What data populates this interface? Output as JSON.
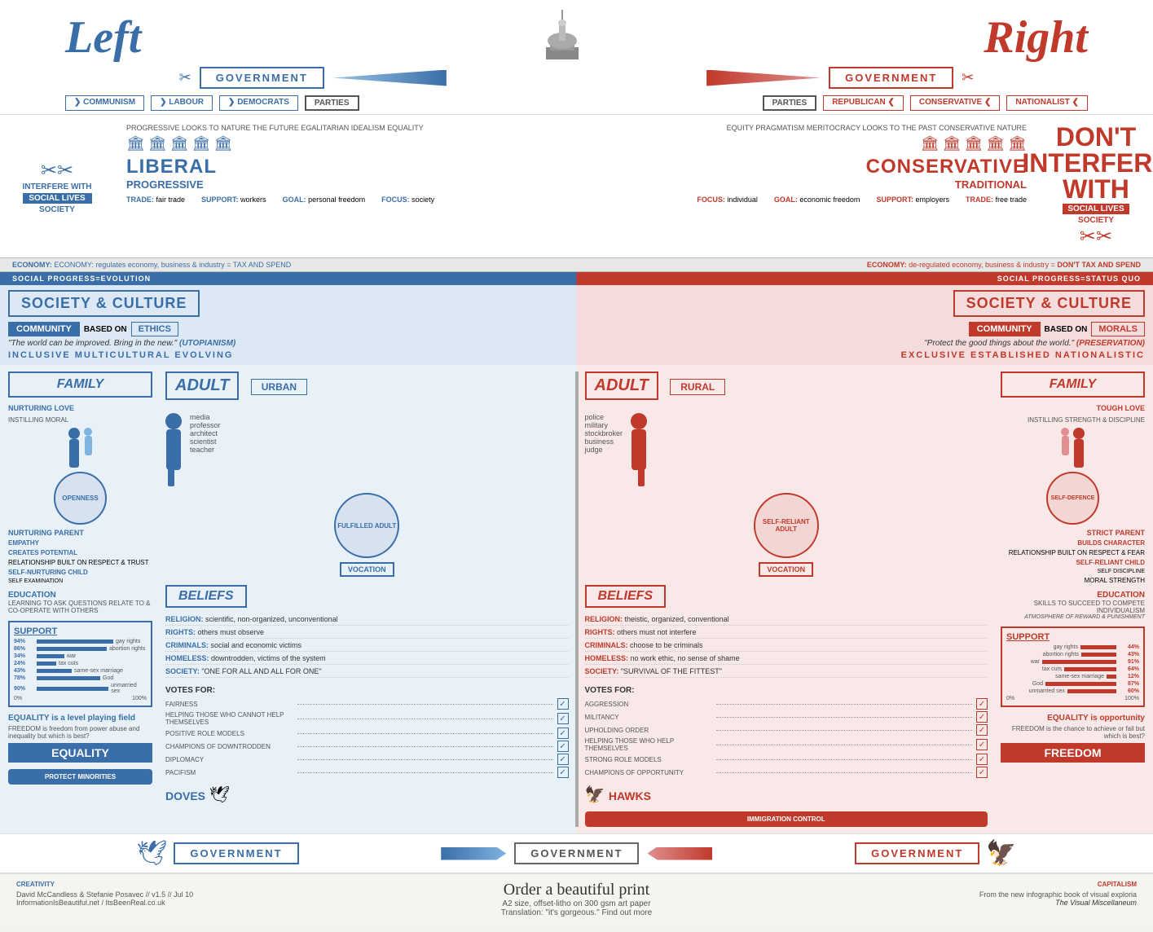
{
  "header": {
    "left_title": "Left",
    "right_title": "Right",
    "government_label": "GOVERNMENT",
    "government_label_right": "GOVERNMENT"
  },
  "parties": {
    "left": [
      "COMMUNISM",
      "LABOUR",
      "DEMOCRATS",
      "PARTIES"
    ],
    "right": [
      "PARTIES",
      "REPUBLICAN",
      "CONSERVATIVE",
      "NATIONALIST"
    ]
  },
  "ideology": {
    "left_main": "LIBERAL",
    "left_sub": "PROGRESSIVE",
    "right_main": "CONSERVATIVE",
    "right_sub": "TRADITIONAL",
    "left_looks": "PROGRESSIVE LOOKS TO NATURE THE FUTURE EGALITARIAN IDEALISM EQUALITY",
    "right_looks": "EQUITY PRAGMATISM MERITOCRACY LOOKS TO THE PAST CONSERVATIVE NATURE"
  },
  "trade": {
    "left": {
      "trade": "TRADE: fair trade",
      "support": "SUPPORT: workers",
      "goal": "GOAL: personal freedom",
      "focus": "FOCUS: society"
    },
    "right": {
      "focus": "FOCUS: individual",
      "goal": "GOAL: economic freedom",
      "support": "SUPPORT: employers",
      "trade": "TRADE: free trade"
    }
  },
  "economy": {
    "left": "ECONOMY: regulates economy, business & industry = TAX AND SPEND",
    "right": "ECONOMY: de-regulated economy, business & industry = DON'T TAX AND SPEND"
  },
  "progress": {
    "left": "SOCIAL PROGRESS=EVOLUTION",
    "right": "SOCIAL PROGRESS=STATUS QUO"
  },
  "society": {
    "left_header": "SOCIETY & CULTURE",
    "right_header": "SOCIETY & CULTURE",
    "left_community": "COMMUNITY",
    "right_community": "COMMUNITY",
    "left_based": "BASED ON",
    "right_based": "BASED ON",
    "left_ethics": "ETHICS",
    "right_morals": "MORALS",
    "left_quote": "\"The world can be improved. Bring in the new.\" (UTOPIANISM)",
    "right_quote": "\"Protect the good things about the world.\" (PRESERVATION)",
    "left_words": "INCLUSIVE   MULTICULTURAL   EVOLVING",
    "right_words": "EXCLUSIVE  ESTABLISHED  NATIONALISTIC"
  },
  "family": {
    "left_title": "FAMILY",
    "right_title": "FAMILY",
    "left_type": "NURTURING LOVE",
    "right_type": "TOUGH LOVE",
    "left_parent": "NURTURING PARENT",
    "right_parent": "STRICT PARENT",
    "left_trait": "OPENNESS",
    "right_trait": "SELF-DEFENCE",
    "left_empathy": "EMPATHY",
    "right_character": "BUILDS CHARACTER",
    "left_potential": "CREATES POTENTIAL",
    "left_instil": "INSTILLING MORAL",
    "right_instil": "INSTILLING STRENGTH & DISCIPLINE",
    "right_moral": "MORAL STRENGTH",
    "left_relationship": "RELATIONSHIP BUILT ON RESPECT & TRUST",
    "right_relationship": "RELATIONSHIP BUILT ON RESPECT & FEAR",
    "left_self": "SELF-NURTURING CHILD",
    "right_self": "SELF-RELIANT CHILD",
    "left_self_exam": "SELF EXAMINATION",
    "right_self_disc": "SELF DISCIPLINE"
  },
  "adult": {
    "left_title": "ADULT",
    "right_title": "ADULT",
    "left_location": "URBAN",
    "right_location": "RURAL",
    "left_fulfilled": "FULFILLED ADULT",
    "right_self_reliant": "SELF-RELIANT ADULT",
    "left_jobs": [
      "media",
      "professor",
      "architect",
      "scientist",
      "teacher"
    ],
    "right_jobs": [
      "police",
      "military",
      "stockbroker",
      "business",
      "judge"
    ],
    "left_vocation": "VOCATION",
    "right_vocation": "VOCATION"
  },
  "education": {
    "left_title": "EDUCATION",
    "right_title": "EDUCATION",
    "left_desc": "LEARNING TO ASK QUESTIONS RELATE TO & CO-OPERATE WITH OTHERS",
    "right_desc": "SKILLS TO SUCCEED TO COMPETE INDIVIDUALISM",
    "right_atmosphere": "ATMOSPHERE OF REWARD & PUNISHMENT"
  },
  "beliefs": {
    "left_title": "BELIEFS",
    "right_title": "BELIEFS",
    "left_items": [
      {
        "label": "RELIGION:",
        "text": "scientific, non-organized, unconventional"
      },
      {
        "label": "RIGHTS:",
        "text": "others must observe"
      },
      {
        "label": "CRIMINALS:",
        "text": "social and economic victims"
      },
      {
        "label": "HOMELESS:",
        "text": "downtrodden, victims of the system"
      },
      {
        "label": "SOCIETY:",
        "text": "\"ONE FOR ALL AND ALL FOR ONE\""
      }
    ],
    "right_items": [
      {
        "label": "RELIGION:",
        "text": "theistic, organized, conventional"
      },
      {
        "label": "RIGHTS:",
        "text": "others must not interfere"
      },
      {
        "label": "CRIMINALS:",
        "text": "choose to be criminals"
      },
      {
        "label": "HOMELESS:",
        "text": "no work ethic, no sense of shame"
      },
      {
        "label": "SOCIETY:",
        "text": "\"SURVIVAL OF THE FITTEST\""
      }
    ]
  },
  "equality": {
    "left_title": "EQUALITY",
    "right_title": "FREEDOM",
    "left_desc": "EQUALITY is a level playing field",
    "left_freedom": "FREEDOM is freedom from power abuse and inequality but which is best?",
    "right_desc": "EQUALITY is opportunity",
    "right_freedom": "FREEDOM is the chance to achieve or fail but which is best?"
  },
  "support": {
    "left_title": "SUPPORT",
    "right_title": "SUPPORT",
    "left_stats": [
      {
        "pct": "94%",
        "label": "gay rights",
        "val": 94
      },
      {
        "pct": "86%",
        "label": "abortion rights",
        "val": 86
      },
      {
        "pct": "34%",
        "label": "war",
        "val": 34
      },
      {
        "pct": "24%",
        "label": "tax cuts",
        "val": 24
      },
      {
        "pct": "43%",
        "label": "same-sex marriage",
        "val": 43
      },
      {
        "pct": "78%",
        "label": "God",
        "val": 78
      },
      {
        "pct": "90%",
        "label": "unmarried sex",
        "val": 90
      }
    ],
    "right_stats": [
      {
        "pct": "44%",
        "label": "gay rights",
        "val": 44
      },
      {
        "pct": "43%",
        "label": "abortion rights",
        "val": 43
      },
      {
        "pct": "91%",
        "label": "war",
        "val": 91
      },
      {
        "pct": "64%",
        "label": "tax cuts",
        "val": 64
      },
      {
        "pct": "12%",
        "label": "same-sex marriage",
        "val": 12
      },
      {
        "pct": "87%",
        "label": "God",
        "val": 87
      },
      {
        "pct": "60%",
        "label": "unmarried sex",
        "val": 60
      }
    ]
  },
  "protect": {
    "left_label": "PROTECT MINORITIES",
    "right_label": "IMMIGRATION CONTROL"
  },
  "votes": {
    "left_title": "VOTES FOR:",
    "right_title": "VOTES FOR:",
    "left_items": [
      {
        "label": "FAIRNESS",
        "icon": "✓"
      },
      {
        "label": "HELPING THOSE WHO CANNOT HELP THEMSELVES",
        "icon": "✓"
      },
      {
        "label": "POSITIVE ROLE MODELS",
        "icon": "✓"
      },
      {
        "label": "CHAMPIONS OF DOWNTRODDEN",
        "icon": "✓"
      }
    ],
    "right_items": [
      {
        "label": "AGGRESSION",
        "icon": "✓"
      },
      {
        "label": "MILITANCY",
        "icon": "✓"
      },
      {
        "label": "UPHOLDING ORDER",
        "icon": "✓"
      },
      {
        "label": "HELPING THOSE WHO HELP THEMSELVES",
        "icon": "✓"
      },
      {
        "label": "STRONG ROLE MODELS",
        "icon": "✓"
      },
      {
        "label": "CHAMPIONS OF OPPORTUNITY",
        "icon": "✓"
      }
    ]
  },
  "diplomacy": {
    "left": [
      {
        "label": "DIPLOMACY",
        "icon": "✓"
      },
      {
        "label": "PACIFISM",
        "icon": "✓"
      }
    ],
    "right": []
  },
  "birds": {
    "left": "DOVES",
    "right": "HAWKS"
  },
  "footer": {
    "creativity": "CREATIVITY",
    "capitalism": "CAPITALISM",
    "attribution": "David McCandless & Stefanie Posavec // v1.5 // Jul 10",
    "website": "InformationIsBeautiful.net / ItsBeenReal.co.uk",
    "cta": "Order a beautiful print",
    "cta_sub1": "A2 size, offset-litho on 300 gsm art paper",
    "cta_sub2": "Translation: \"it's gorgeous.\" Find out more",
    "book_ref": "From the new infographic book of visual exploria",
    "book_title": "The Visual Miscellaneum"
  },
  "interfere": {
    "left_line1": "INTERFERE WITH",
    "left_line2": "SOCIAL LIVES",
    "left_label": "SOCIETY",
    "right_line1": "DON'T",
    "right_line2": "INTERFERE WITH",
    "right_label": "SOCIETY",
    "right_social": "SOCIAL LIVES"
  }
}
